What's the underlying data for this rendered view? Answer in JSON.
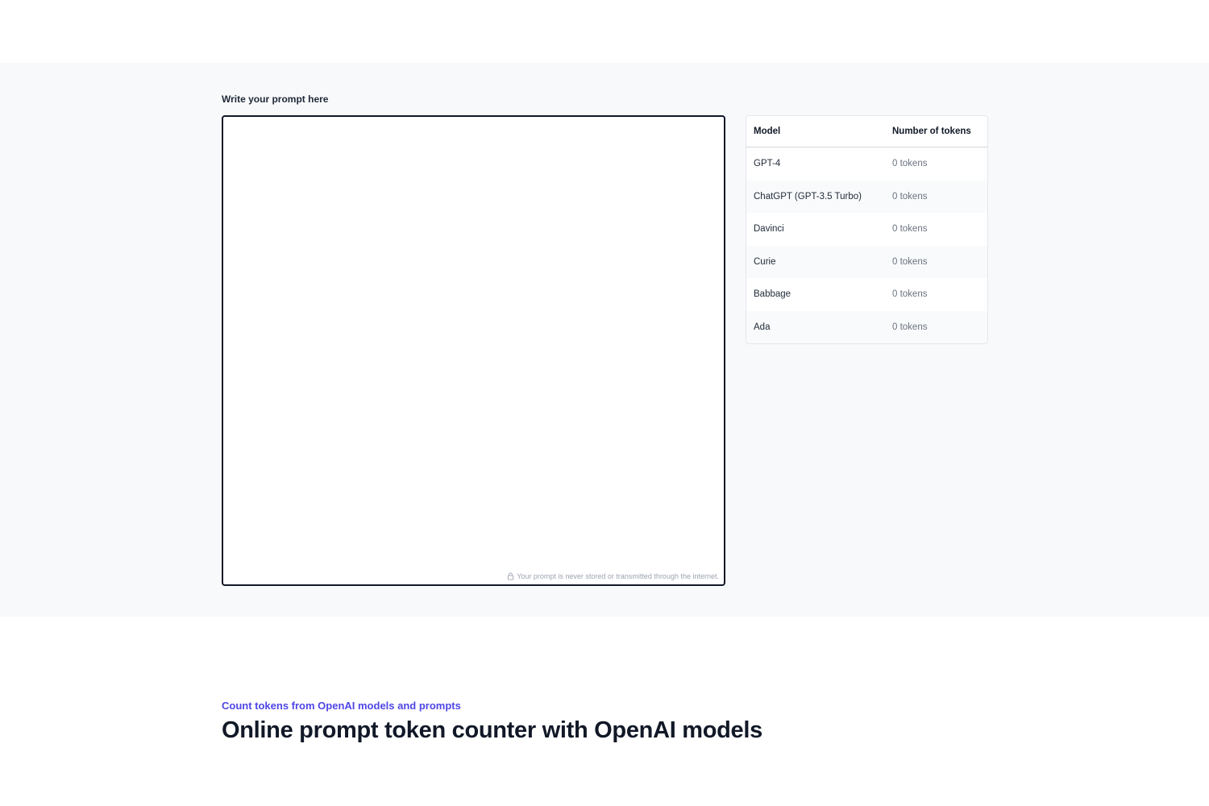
{
  "tool": {
    "prompt_label": "Write your prompt here",
    "prompt_value": "",
    "privacy_note": "Your prompt is never stored or transmitted through the internet.",
    "table": {
      "headers": {
        "model": "Model",
        "tokens": "Number of tokens"
      },
      "rows": [
        {
          "model": "GPT-4",
          "tokens": "0 tokens"
        },
        {
          "model": "ChatGPT (GPT-3.5 Turbo)",
          "tokens": "0 tokens"
        },
        {
          "model": "Davinci",
          "tokens": "0 tokens"
        },
        {
          "model": "Curie",
          "tokens": "0 tokens"
        },
        {
          "model": "Babbage",
          "tokens": "0 tokens"
        },
        {
          "model": "Ada",
          "tokens": "0 tokens"
        }
      ]
    }
  },
  "content": {
    "eyebrow": "Count tokens from OpenAI models and prompts",
    "headline": "Online prompt token counter with OpenAI models"
  },
  "colors": {
    "accent": "#4f46e5",
    "section_bg": "#f8f9fb",
    "text": "#111827"
  },
  "icons": {
    "privacy": "lock-icon"
  }
}
